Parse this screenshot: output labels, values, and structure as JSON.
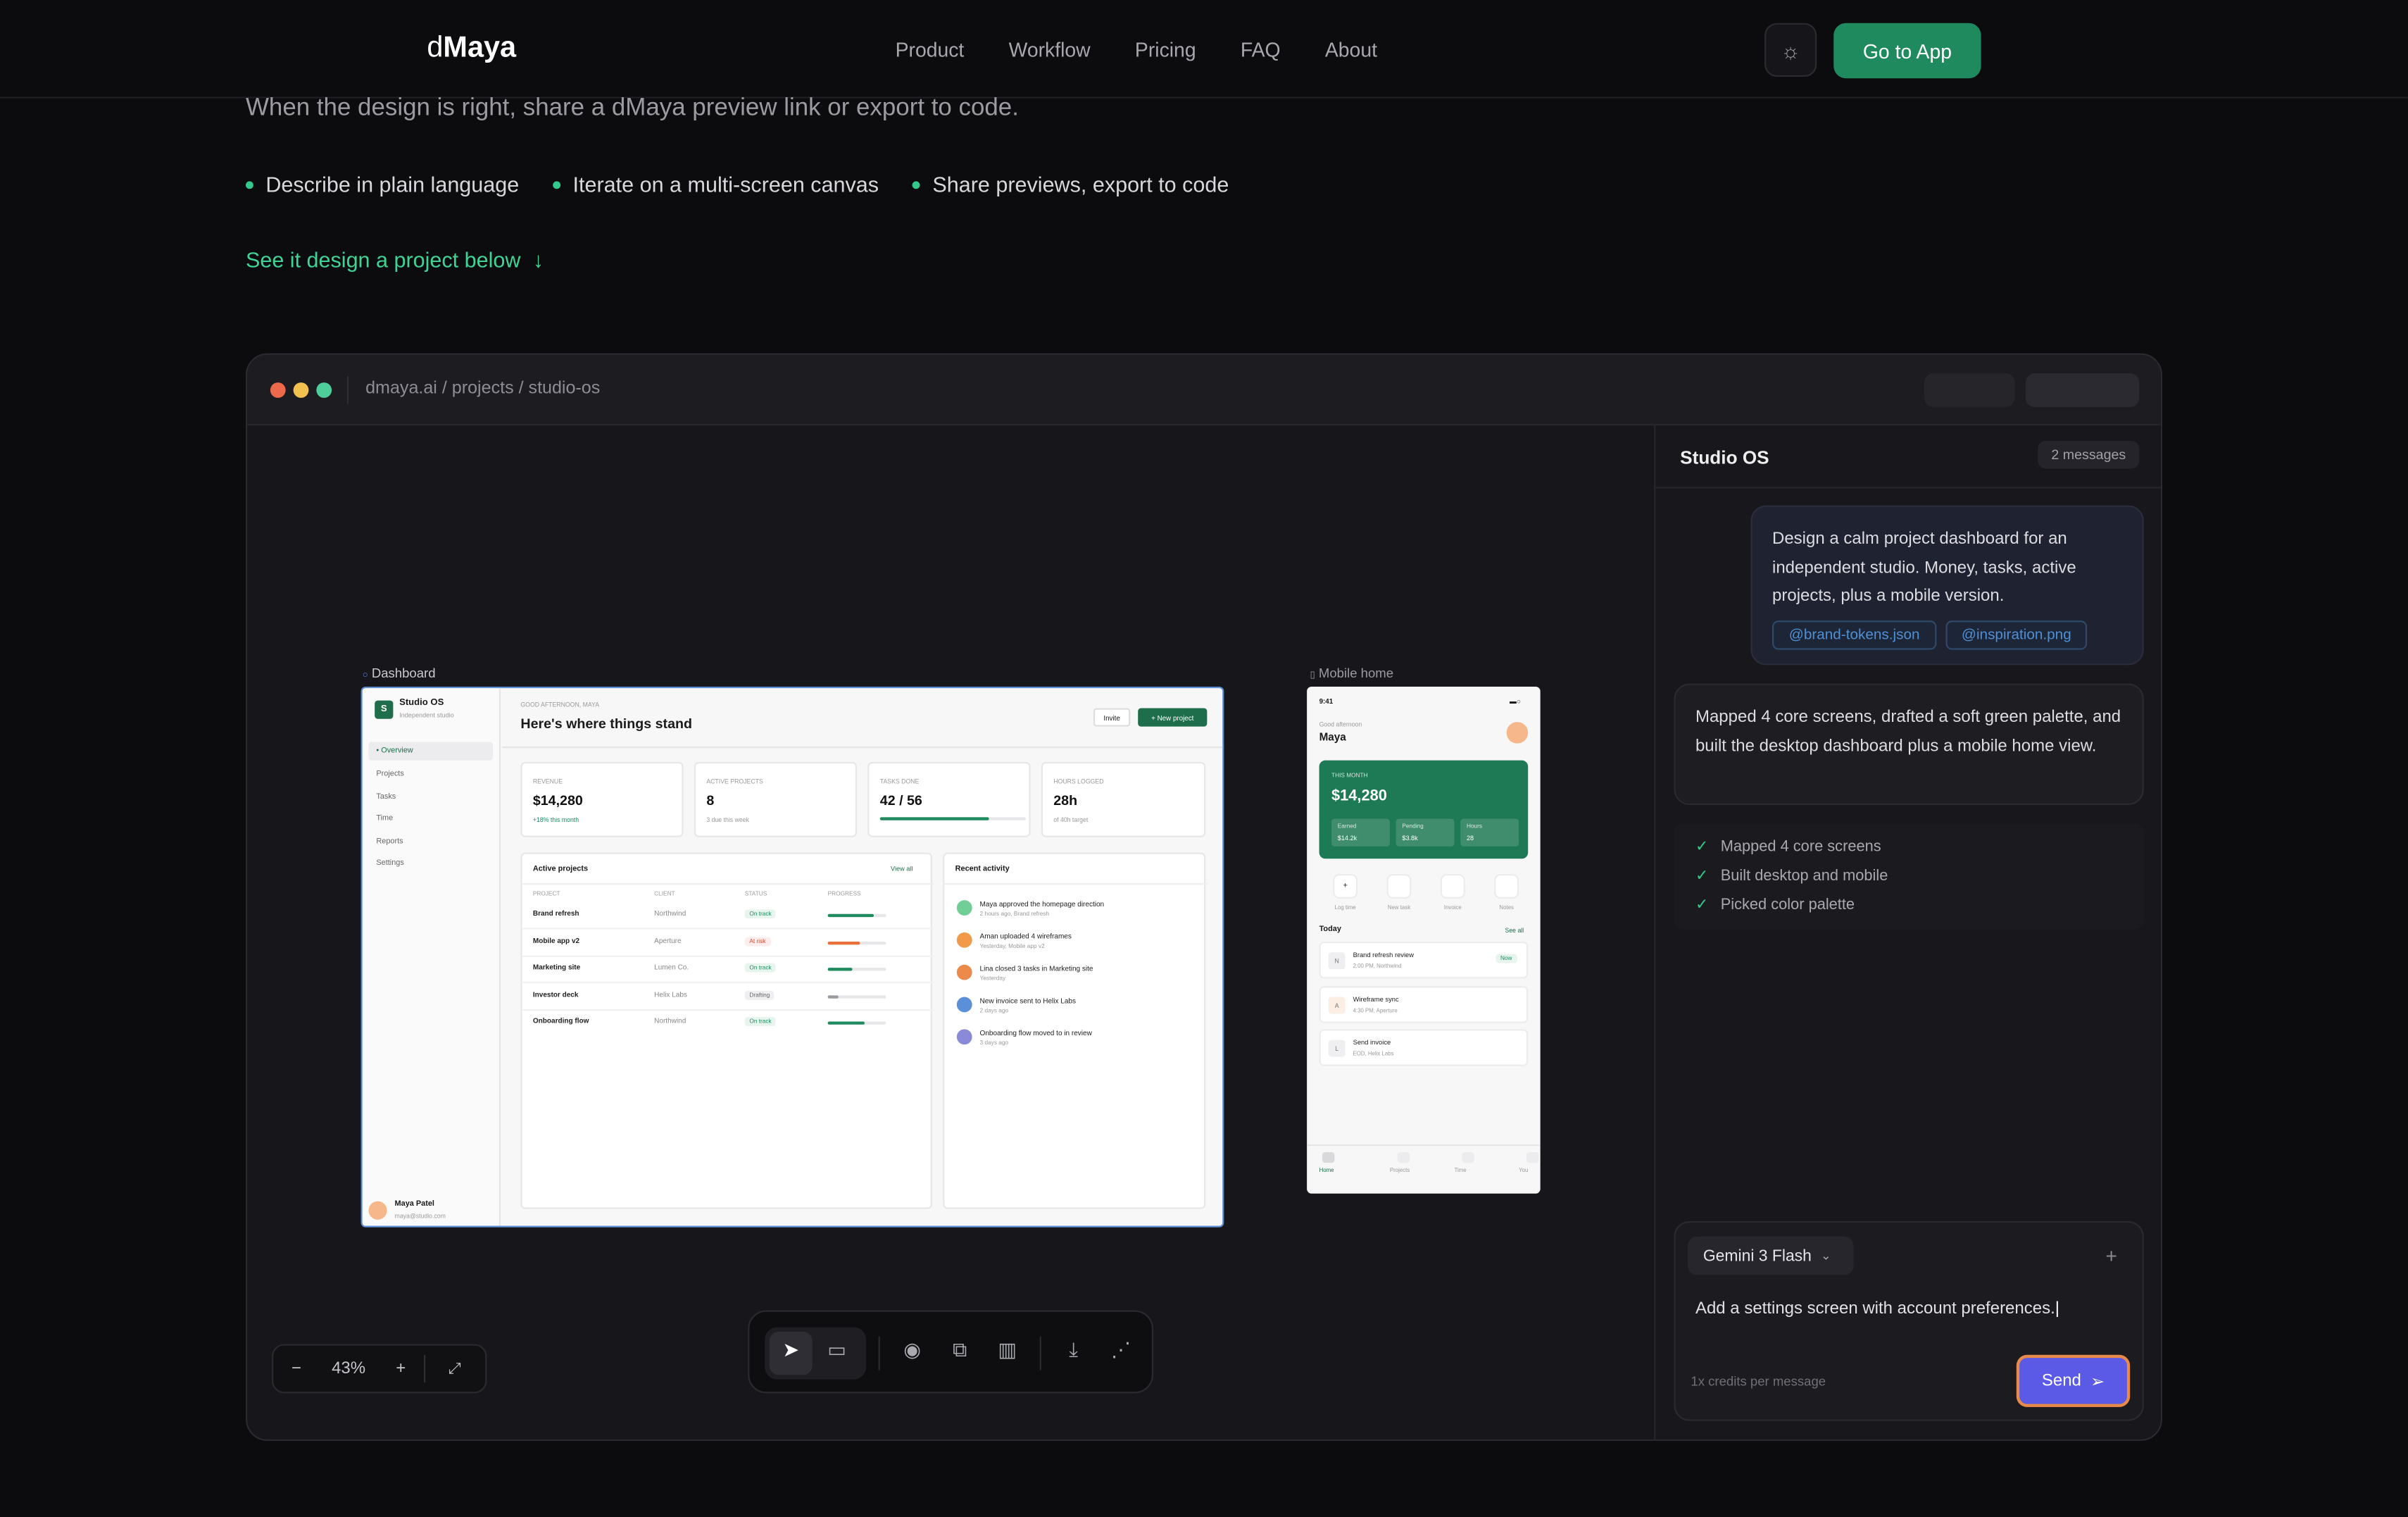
{
  "nav": {
    "logo_prefix": "d",
    "logo_main": "Maya",
    "links": [
      "Product",
      "Workflow",
      "Pricing",
      "FAQ",
      "About"
    ],
    "cta": "Go to App"
  },
  "hero": {
    "subtitle": "When the design is right, share a dMaya preview link or export to code.",
    "features": [
      "Describe in plain language",
      "Iterate on a multi-screen canvas",
      "Share previews, export to code"
    ],
    "see_it": "See it design a project below"
  },
  "window": {
    "path": "dmaya.ai / projects / studio-os"
  },
  "canvas": {
    "dashboard_label": "Dashboard",
    "mobile_label": "Mobile home",
    "zoom": "43%"
  },
  "dashboard": {
    "brand_initial": "S",
    "brand": "Studio OS",
    "brand_sub": "Independent studio",
    "nav": [
      "Overview",
      "Projects",
      "Tasks",
      "Time",
      "Reports",
      "Settings"
    ],
    "greeting": "GOOD AFTERNOON, MAYA",
    "headline": "Here's where things stand",
    "invite": "Invite",
    "new_project": "+ New project",
    "kpis": [
      {
        "label": "REVENUE",
        "value": "$14,280",
        "note": "+18% this month"
      },
      {
        "label": "ACTIVE PROJECTS",
        "value": "8",
        "note": "3 due this week"
      },
      {
        "label": "TASKS DONE",
        "value": "42 / 56",
        "note": ""
      },
      {
        "label": "HOURS LOGGED",
        "value": "28h",
        "note": "of 40h target"
      }
    ],
    "projects_title": "Active projects",
    "view_all": "View all",
    "columns": [
      "PROJECT",
      "CLIENT",
      "STATUS",
      "PROGRESS"
    ],
    "rows": [
      {
        "project": "Brand refresh",
        "client": "Northwind",
        "status": "On track",
        "progress": 0.8,
        "color": "#1e8a5e"
      },
      {
        "project": "Mobile app v2",
        "client": "Aperture",
        "status": "At risk",
        "progress": 0.55,
        "color": "#e8733a"
      },
      {
        "project": "Marketing site",
        "client": "Lumen Co.",
        "status": "On track",
        "progress": 0.42,
        "color": "#1e8a5e"
      },
      {
        "project": "Investor deck",
        "client": "Helix Labs",
        "status": "Drafting",
        "progress": 0.18,
        "color": "#9a9aa0"
      },
      {
        "project": "Onboarding flow",
        "client": "Northwind",
        "status": "On track",
        "progress": 0.62,
        "color": "#1e8a5e"
      }
    ],
    "activity_title": "Recent activity",
    "activity": [
      {
        "text": "Maya approved the homepage direction",
        "meta": "2 hours ago, Brand refresh",
        "color": "#6fcf97"
      },
      {
        "text": "Aman uploaded 4 wireframes",
        "meta": "Yesterday, Mobile app v2",
        "color": "#f2994a"
      },
      {
        "text": "Lina closed 3 tasks in Marketing site",
        "meta": "Yesterday",
        "color": "#eb8a4a"
      },
      {
        "text": "New invoice sent to Helix Labs",
        "meta": "2 days ago",
        "color": "#5b8fd8"
      },
      {
        "text": "Onboarding flow moved to in review",
        "meta": "3 days ago",
        "color": "#8a8ad8"
      }
    ],
    "user_name": "Maya Patel",
    "user_email": "maya@studio.com"
  },
  "mobile": {
    "time": "9:41",
    "greeting": "Good afternoon",
    "name": "Maya",
    "card_label": "THIS MONTH",
    "amount": "$14,280",
    "stats": [
      {
        "label": "Earned",
        "value": "$14.2k"
      },
      {
        "label": "Pending",
        "value": "$3.8k"
      },
      {
        "label": "Hours",
        "value": "28"
      }
    ],
    "actions": [
      "Log time",
      "New task",
      "Invoice",
      "Notes"
    ],
    "today": "Today",
    "see_all": "See all",
    "items": [
      {
        "initial": "N",
        "title": "Brand refresh review",
        "meta": "2:00 PM, Northwind",
        "badge": "Now"
      },
      {
        "initial": "A",
        "title": "Wireframe sync",
        "meta": "4:30 PM, Aperture",
        "badge": ""
      },
      {
        "initial": "L",
        "title": "Send invoice",
        "meta": "EOD, Helix Labs",
        "badge": ""
      }
    ],
    "tabs": [
      "Home",
      "Projects",
      "Time",
      "You"
    ]
  },
  "chat": {
    "title": "Studio OS",
    "count": "2 messages",
    "user_message": "Design a calm project dashboard for an independent studio. Money, tasks, active projects, plus a mobile version.",
    "attachments": [
      "@brand-tokens.json",
      "@inspiration.png"
    ],
    "assistant_message": "Mapped 4 core screens, drafted a soft green palette, and built the desktop dashboard plus a mobile home view.",
    "steps": [
      "Mapped 4 core screens",
      "Built desktop and mobile",
      "Picked color palette"
    ],
    "model": "Gemini 3 Flash",
    "input": "Add a settings screen with account preferences.",
    "credits": "1x credits per message",
    "send": "Send"
  }
}
